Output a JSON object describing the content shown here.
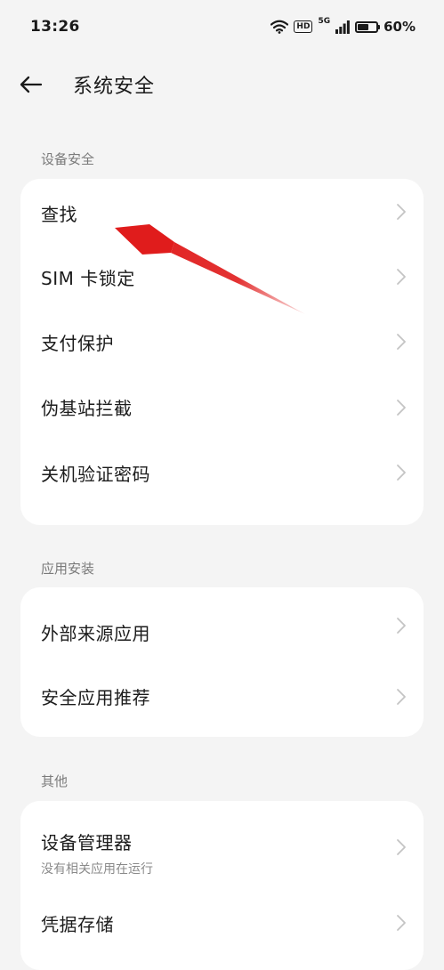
{
  "status_bar": {
    "time": "13:26",
    "hd": "HD",
    "network": "5G",
    "battery_percent": "60%",
    "battery_level": 0.6
  },
  "header": {
    "title": "系统安全"
  },
  "sections": [
    {
      "label": "设备安全",
      "items": [
        {
          "label": "查找"
        },
        {
          "label": "SIM 卡锁定"
        },
        {
          "label": "支付保护"
        },
        {
          "label": "伪基站拦截"
        },
        {
          "label": "关机验证密码"
        }
      ]
    },
    {
      "label": "应用安装",
      "items": [
        {
          "label": "外部来源应用"
        },
        {
          "label": "安全应用推荐"
        }
      ]
    },
    {
      "label": "其他",
      "items": [
        {
          "label": "设备管理器",
          "sublabel": "没有相关应用在运行"
        },
        {
          "label": "凭据存储"
        }
      ]
    }
  ],
  "colors": {
    "background": "#f4f4f4",
    "card": "#ffffff",
    "annotation_arrow": "#e01c1c"
  }
}
